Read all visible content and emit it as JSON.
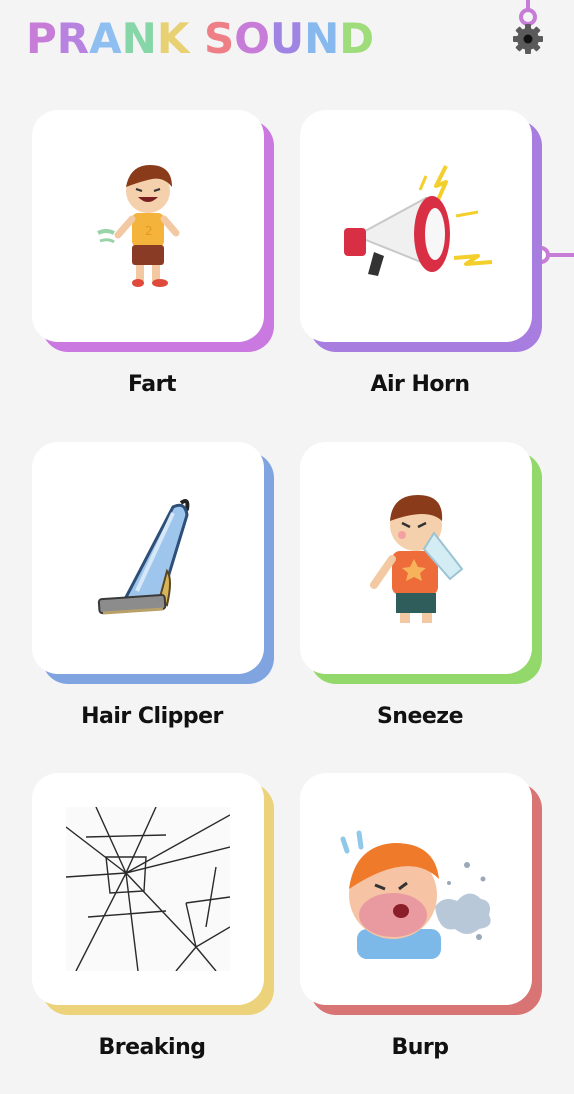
{
  "header": {
    "title_letters": [
      {
        "ch": "P",
        "color": "#c77dd8"
      },
      {
        "ch": "R",
        "color": "#b882e0"
      },
      {
        "ch": "A",
        "color": "#8fbff0"
      },
      {
        "ch": "N",
        "color": "#86d6a8"
      },
      {
        "ch": "K",
        "color": "#e7d172"
      },
      {
        "ch": " ",
        "color": "#000000"
      },
      {
        "ch": "S",
        "color": "#ee7f86"
      },
      {
        "ch": "O",
        "color": "#c77dd8"
      },
      {
        "ch": "U",
        "color": "#a084e4"
      },
      {
        "ch": "N",
        "color": "#87b8ee"
      },
      {
        "ch": "D",
        "color": "#9fdc7c"
      }
    ],
    "settings_icon": "gear-icon"
  },
  "accent_line_color": "#c77dd8",
  "sounds": [
    {
      "label": "Fart",
      "shadow_color": "#c979e0",
      "icon": "boy-fart-icon"
    },
    {
      "label": "Air Horn",
      "shadow_color": "#a87de0",
      "icon": "megaphone-icon"
    },
    {
      "label": "Hair Clipper",
      "shadow_color": "#7fa4e0",
      "icon": "hair-clipper-icon"
    },
    {
      "label": "Sneeze",
      "shadow_color": "#93d86a",
      "icon": "boy-sneeze-icon"
    },
    {
      "label": "Breaking",
      "shadow_color": "#ecd27a",
      "icon": "broken-glass-icon"
    },
    {
      "label": "Burp",
      "shadow_color": "#d97474",
      "icon": "boy-burp-icon"
    }
  ]
}
